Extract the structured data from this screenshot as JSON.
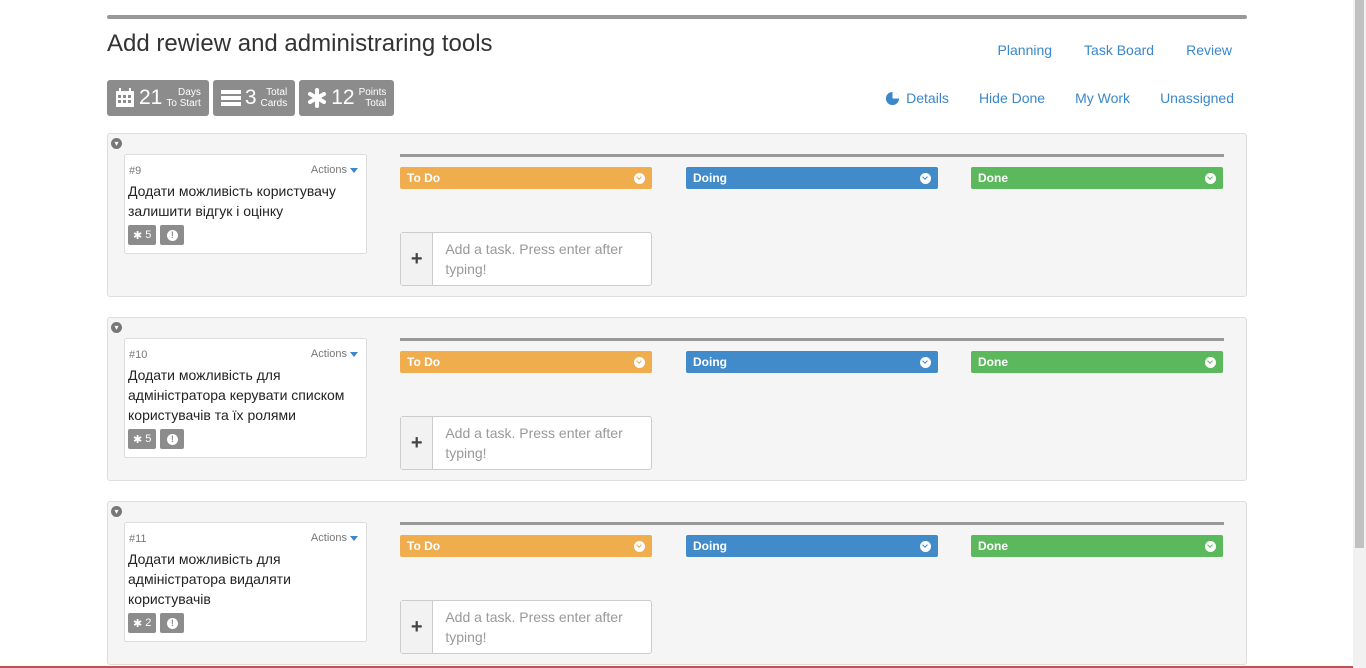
{
  "page": {
    "title": "Add rewiew and administraring tools"
  },
  "topnav": [
    "Planning",
    "Task Board",
    "Review"
  ],
  "subnav": {
    "details": "Details",
    "hide_done": "Hide Done",
    "my_work": "My Work",
    "unassigned": "Unassigned"
  },
  "stats": [
    {
      "icon": "calendar-icon",
      "num": "21",
      "line1": "Days",
      "line2": "To Start"
    },
    {
      "icon": "cards-icon",
      "num": "3",
      "line1": "Total",
      "line2": "Cards"
    },
    {
      "icon": "asterisk-icon",
      "num": "12",
      "line1": "Points",
      "line2": "Total"
    }
  ],
  "columns": [
    "To Do",
    "Doing",
    "Done"
  ],
  "colors": {
    "todo": "#f0ad4e",
    "doing": "#428bca",
    "done": "#5cb85c",
    "link": "#3a87c9"
  },
  "stories": [
    {
      "id": "#9",
      "actions": "Actions",
      "title": "Додати можливість користувачу залишити відгук і оцінку",
      "points": "5"
    },
    {
      "id": "#10",
      "actions": "Actions",
      "title": "Додати можливість для адміністратора керувати списком користувачів та їх ролями",
      "points": "5"
    },
    {
      "id": "#11",
      "actions": "Actions",
      "title": "Додати можливість для адміністратора видаляти користувачів",
      "points": "2"
    }
  ],
  "add_task_placeholder": "Add a task. Press enter after typing!"
}
